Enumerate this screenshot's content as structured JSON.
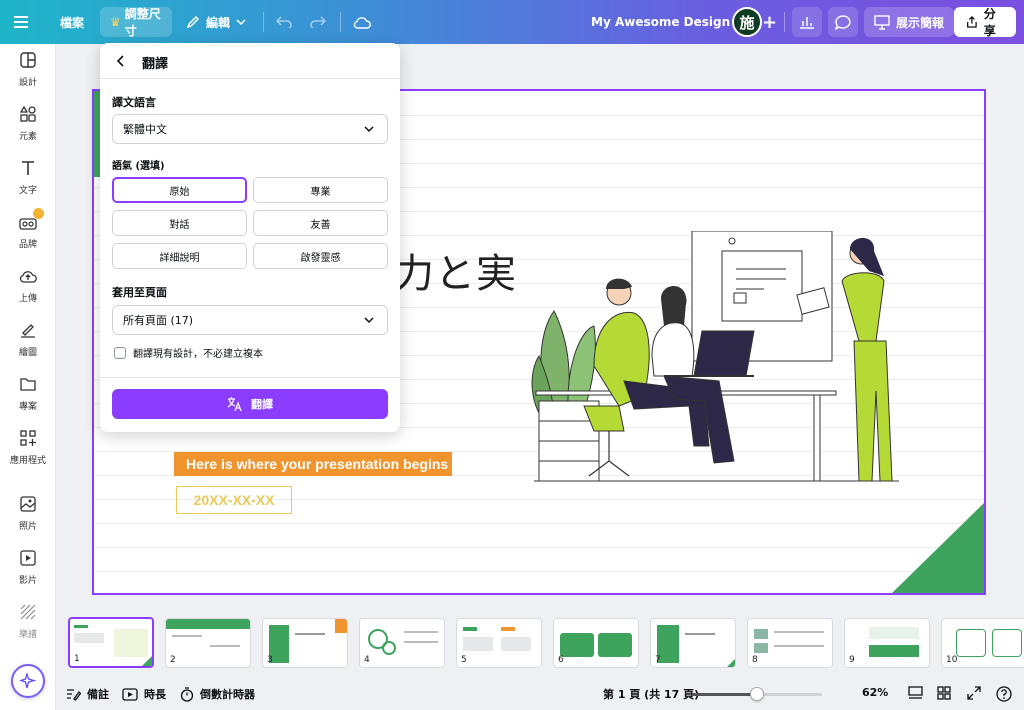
{
  "topbar": {
    "file": "檔案",
    "resize": "調整尺寸",
    "edit": "編輯",
    "design_title": "My Awesome Design 🤩",
    "avatar_initial": "施",
    "present": "展示簡報",
    "share": "分享"
  },
  "sidebar": {
    "items": [
      {
        "label": "設計",
        "icon": "layout-icon"
      },
      {
        "label": "元素",
        "icon": "shapes-icon"
      },
      {
        "label": "文字",
        "icon": "text-icon"
      },
      {
        "label": "品牌",
        "icon": "brand-icon"
      },
      {
        "label": "上傳",
        "icon": "upload-icon"
      },
      {
        "label": "繪圖",
        "icon": "draw-icon"
      },
      {
        "label": "專案",
        "icon": "folder-icon"
      },
      {
        "label": "應用程式",
        "icon": "apps-icon"
      },
      {
        "label": "照片",
        "icon": "photo-icon"
      },
      {
        "label": "影片",
        "icon": "video-icon"
      },
      {
        "label": "樂譜",
        "icon": "pattern-icon"
      }
    ]
  },
  "panel": {
    "title": "翻譯",
    "target_language_label": "譯文語言",
    "target_language_value": "繁體中文",
    "tone_label": "語氣 (選填)",
    "tones": [
      "原始",
      "專業",
      "對話",
      "友善",
      "詳細說明",
      "啟發靈感"
    ],
    "selected_tone": "原始",
    "apply_label": "套用至頁面",
    "apply_value": "所有頁面 (17)",
    "checkbox_label": "翻譯現有設計，不必建立複本",
    "checkbox_checked": false,
    "translate_button": "翻譯"
  },
  "slide": {
    "title_fragment": "力と実",
    "banner": "Here is where your presentation begins",
    "date": "20XX-XX-XX"
  },
  "pages": {
    "numbers": [
      "1",
      "2",
      "3",
      "4",
      "5",
      "6",
      "7",
      "8",
      "9",
      "10"
    ],
    "selected": 1
  },
  "bottombar": {
    "notes": "備註",
    "duration": "時長",
    "timer": "倒數計時器",
    "page_info": "第 1 頁 (共 17 頁)",
    "zoom": "62%",
    "zoom_fraction": 0.5
  },
  "colors": {
    "accent": "#8b3dff",
    "green": "#3da35d",
    "orange": "#f0952d",
    "lime": "#b5d935"
  }
}
